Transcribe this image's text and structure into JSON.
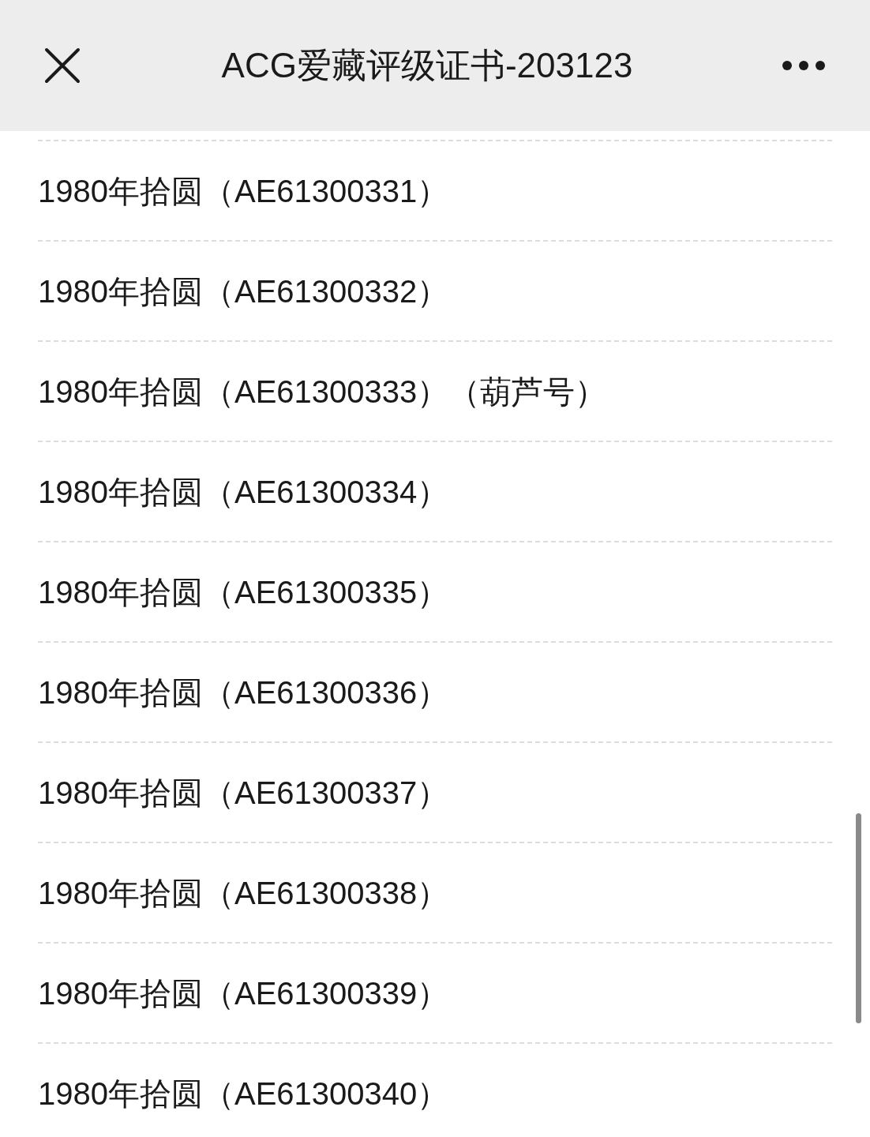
{
  "header": {
    "title": "ACG爱藏评级证书-203123"
  },
  "items": [
    {
      "text": "1980年拾圆（AE61300331）"
    },
    {
      "text": "1980年拾圆（AE61300332）"
    },
    {
      "text": "1980年拾圆（AE61300333）（葫芦号）"
    },
    {
      "text": "1980年拾圆（AE61300334）"
    },
    {
      "text": "1980年拾圆（AE61300335）"
    },
    {
      "text": "1980年拾圆（AE61300336）"
    },
    {
      "text": "1980年拾圆（AE61300337）"
    },
    {
      "text": "1980年拾圆（AE61300338）"
    },
    {
      "text": "1980年拾圆（AE61300339）"
    },
    {
      "text": "1980年拾圆（AE61300340）"
    }
  ]
}
